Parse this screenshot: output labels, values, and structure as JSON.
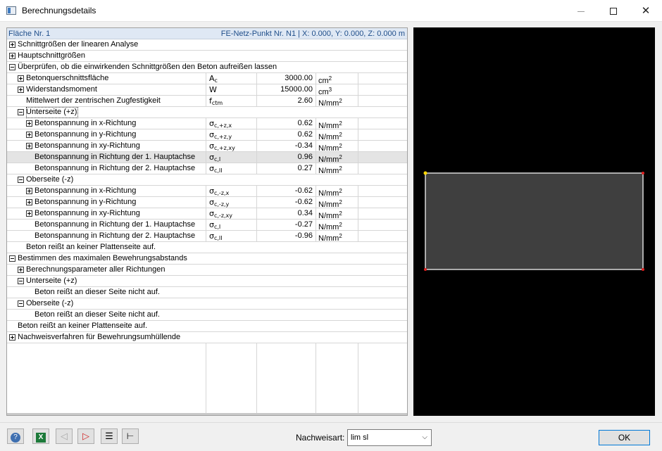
{
  "window": {
    "title": "Berechnungsdetails"
  },
  "table": {
    "left_header": "Fläche Nr. 1",
    "right_header": "FE-Netz-Punkt Nr. N1  |  X: 0.000, Y: 0.000, Z: 0.000 m",
    "rows": [
      {
        "label": "Schnittgrößen der linearen Analyse",
        "toggle": "plus",
        "indent": 0,
        "full": true
      },
      {
        "label": "Hauptschnittgrößen",
        "toggle": "plus",
        "indent": 0,
        "full": true
      },
      {
        "label": "Überprüfen, ob die einwirkenden Schnittgrößen den Beton aufreißen lassen",
        "toggle": "minus",
        "indent": 0,
        "full": true
      },
      {
        "label": "Betonquerschnittsfläche",
        "toggle": "plus",
        "indent": 1,
        "sym": "A",
        "sub": "c",
        "value": "3000.00",
        "unit": "cm",
        "sup": "2"
      },
      {
        "label": "Widerstandsmoment",
        "toggle": "plus",
        "indent": 1,
        "sym": "W",
        "sub": "",
        "value": "15000.00",
        "unit": "cm",
        "sup": "3"
      },
      {
        "label": "Mittelwert der zentrischen Zugfestigkeit",
        "toggle": "",
        "indent": 1,
        "sym": "f",
        "sub": "ctm",
        "value": "2.60",
        "unit": "N/mm",
        "sup": "2"
      },
      {
        "label": "Unterseite (+z)",
        "toggle": "minus",
        "indent": 1,
        "full": true,
        "focus": true
      },
      {
        "label": "Betonspannung in x-Richtung",
        "toggle": "plus",
        "indent": 2,
        "sym": "σ",
        "sub": "c,+z,x",
        "value": "0.62",
        "unit": "N/mm",
        "sup": "2"
      },
      {
        "label": "Betonspannung in y-Richtung",
        "toggle": "plus",
        "indent": 2,
        "sym": "σ",
        "sub": "c,+z,y",
        "value": "0.62",
        "unit": "N/mm",
        "sup": "2"
      },
      {
        "label": "Betonspannung in xy-Richtung",
        "toggle": "plus",
        "indent": 2,
        "sym": "σ",
        "sub": "c,+z,xy",
        "value": "-0.34",
        "unit": "N/mm",
        "sup": "2"
      },
      {
        "label": "Betonspannung in Richtung der 1. Hauptachse",
        "toggle": "",
        "indent": 2,
        "sym": "σ",
        "sub": "c,I",
        "value": "0.96",
        "unit": "N/mm",
        "sup": "2",
        "selected": true
      },
      {
        "label": "Betonspannung in Richtung der 2. Hauptachse",
        "toggle": "",
        "indent": 2,
        "sym": "σ",
        "sub": "c,II",
        "value": "0.27",
        "unit": "N/mm",
        "sup": "2"
      },
      {
        "label": "Oberseite (-z)",
        "toggle": "minus",
        "indent": 1,
        "full": true
      },
      {
        "label": "Betonspannung in x-Richtung",
        "toggle": "plus",
        "indent": 2,
        "sym": "σ",
        "sub": "c,-z,x",
        "value": "-0.62",
        "unit": "N/mm",
        "sup": "2"
      },
      {
        "label": "Betonspannung in y-Richtung",
        "toggle": "plus",
        "indent": 2,
        "sym": "σ",
        "sub": "c,-z,y",
        "value": "-0.62",
        "unit": "N/mm",
        "sup": "2"
      },
      {
        "label": "Betonspannung in xy-Richtung",
        "toggle": "plus",
        "indent": 2,
        "sym": "σ",
        "sub": "c,-z,xy",
        "value": "0.34",
        "unit": "N/mm",
        "sup": "2"
      },
      {
        "label": "Betonspannung in Richtung der 1. Hauptachse",
        "toggle": "",
        "indent": 2,
        "sym": "σ",
        "sub": "c,I",
        "value": "-0.27",
        "unit": "N/mm",
        "sup": "2"
      },
      {
        "label": "Betonspannung in Richtung der 2. Hauptachse",
        "toggle": "",
        "indent": 2,
        "sym": "σ",
        "sub": "c,II",
        "value": "-0.96",
        "unit": "N/mm",
        "sup": "2"
      },
      {
        "label": "Beton reißt an keiner Plattenseite auf.",
        "toggle": "",
        "indent": 1,
        "full": true
      },
      {
        "label": "Bestimmen des maximalen Bewehrungsabstands",
        "toggle": "minus",
        "indent": 0,
        "full": true
      },
      {
        "label": "Berechnungsparameter aller Richtungen",
        "toggle": "plus",
        "indent": 1,
        "full": true
      },
      {
        "label": "Unterseite (+z)",
        "toggle": "minus",
        "indent": 1,
        "full": true
      },
      {
        "label": "Beton reißt an dieser Seite nicht auf.",
        "toggle": "",
        "indent": 2,
        "full": true
      },
      {
        "label": "Oberseite (-z)",
        "toggle": "minus",
        "indent": 1,
        "full": true
      },
      {
        "label": "Beton reißt an dieser Seite nicht auf.",
        "toggle": "",
        "indent": 2,
        "full": true
      },
      {
        "label": "Beton reißt an keiner Plattenseite auf.",
        "toggle": "",
        "indent": 0,
        "full": true
      },
      {
        "label": "Nachweisverfahren für Bewehrungsumhüllende",
        "toggle": "plus",
        "indent": 0,
        "full": true
      }
    ]
  },
  "footer": {
    "nachweisart_label": "Nachweisart:",
    "nachweisart_value": "lim sl",
    "ok_label": "OK",
    "toolbar_icons": [
      "help-icon",
      "excel-icon",
      "previous-icon",
      "next-icon",
      "list-icon",
      "tree-icon"
    ]
  },
  "colors": {
    "panel_header_bg": "#dfe8f4",
    "panel_header_text": "#1f4e8a",
    "preview_bg": "#000000",
    "slab_fill": "#3f3f3f",
    "slab_outline": "#d9d9d9",
    "corner_node": "#ffd700",
    "other_nodes": "#e02020",
    "ok_border": "#0078d7"
  }
}
